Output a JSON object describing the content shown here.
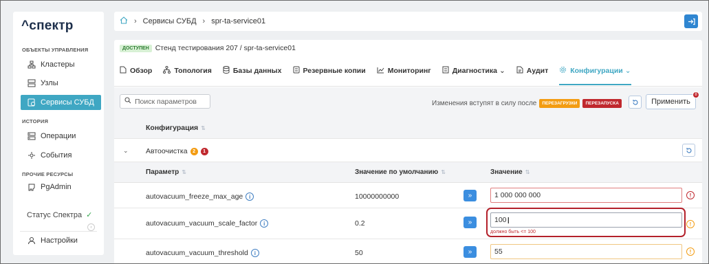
{
  "sidebar": {
    "logo": "^спектр",
    "sections": {
      "manage": "ОБЪЕКТЫ УПРАВЛЕНИЯ",
      "history": "ИСТОРИЯ",
      "other": "ПРОЧИЕ РЕСУРСЫ"
    },
    "items": {
      "clusters": "Кластеры",
      "nodes": "Узлы",
      "dbms": "Сервисы СУБД",
      "operations": "Операции",
      "events": "События",
      "pgadmin": "PgAdmin",
      "settings": "Настройки"
    },
    "status": "Статус Спектра"
  },
  "breadcrumb": {
    "level1": "Сервисы СУБД",
    "level2": "spr-ta-service01"
  },
  "service": {
    "badge": "ДОСТУПЕН",
    "path": "Стенд тестирования 207 / spr-ta-service01"
  },
  "tabs": {
    "overview": "Обзор",
    "topology": "Топология",
    "databases": "Базы данных",
    "backups": "Резервные копии",
    "monitoring": "Мониторинг",
    "diagnostics": "Диагностика",
    "audit": "Аудит",
    "config": "Конфигурации"
  },
  "toolbar": {
    "search_placeholder": "Поиск параметров",
    "changes_text": "Изменения вступят в силу после",
    "reload_pill": "ПЕРЕЗАГРУЗКИ",
    "restart_pill": "ПЕРЕЗАПУСКА",
    "apply_label": "Применить",
    "apply_count": "8"
  },
  "table": {
    "config_header": "Конфигурация",
    "group": {
      "name": "Автоочистка",
      "warn_count": "2",
      "error_count": "1"
    },
    "columns": {
      "param": "Параметр",
      "default": "Значение по умолчанию",
      "value": "Значение"
    },
    "rows": [
      {
        "name": "autovacuum_freeze_max_age",
        "default": "10000000000",
        "value": "1 000 000 000",
        "hint": ""
      },
      {
        "name": "autovacuum_vacuum_scale_factor",
        "default": "0.2",
        "value": "100",
        "hint": "должно быть <= 100"
      },
      {
        "name": "autovacuum_vacuum_threshold",
        "default": "50",
        "value": "55",
        "hint": ""
      }
    ]
  },
  "icons": {
    "info": "i",
    "copy": "»",
    "error": "!"
  },
  "colors": {
    "accent": "#3fa7c3",
    "primary_button": "#3b8ee0",
    "error": "#c0282e",
    "warning": "#f39c12",
    "available_badge": "#d8f1d5"
  }
}
